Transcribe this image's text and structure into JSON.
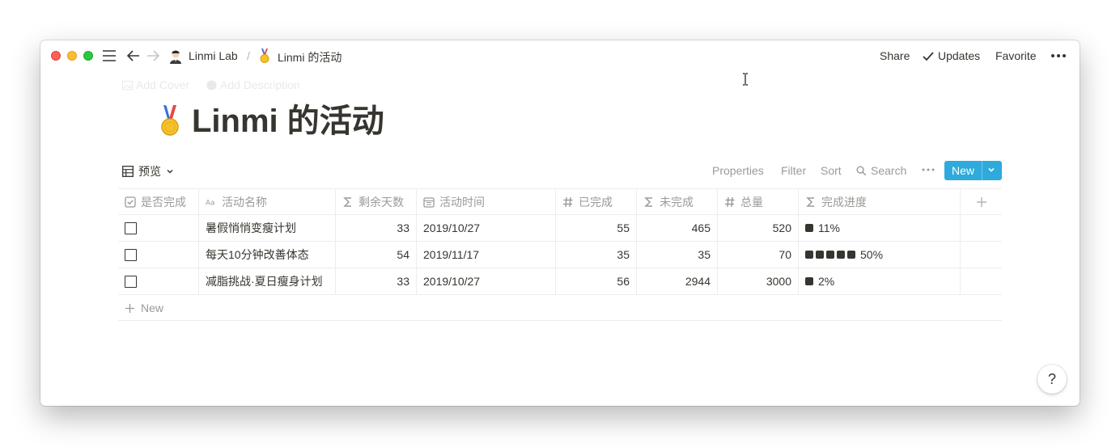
{
  "breadcrumb": {
    "workspace": "Linmi Lab",
    "separator": "/",
    "page": "Linmi 的活动"
  },
  "topbar": {
    "share": "Share",
    "updates": "Updates",
    "favorite": "Favorite"
  },
  "page_actions": {
    "add_cover": "Add Cover",
    "add_description": "Add Description"
  },
  "page": {
    "title": "Linmi 的活动",
    "icon": "medal-icon"
  },
  "view": {
    "name": "预览"
  },
  "toolbar": {
    "properties": "Properties",
    "filter": "Filter",
    "sort": "Sort",
    "search": "Search",
    "new": "New"
  },
  "table": {
    "columns": [
      {
        "label": "是否完成",
        "icon": "checkbox-icon"
      },
      {
        "label": "活动名称",
        "icon": "text-icon"
      },
      {
        "label": "剩余天数",
        "icon": "formula-icon"
      },
      {
        "label": "活动时间",
        "icon": "calendar-icon"
      },
      {
        "label": "已完成",
        "icon": "number-icon"
      },
      {
        "label": "未完成",
        "icon": "formula-icon"
      },
      {
        "label": "总量",
        "icon": "number-icon"
      },
      {
        "label": "完成进度",
        "icon": "formula-icon"
      }
    ],
    "rows": [
      {
        "done": false,
        "name": "暑假悄悄变瘦计划",
        "days_left": "33",
        "date": "2019/10/27",
        "completed": "55",
        "remaining": "465",
        "total": "520",
        "progress_text": "11%",
        "progress": 0.11
      },
      {
        "done": false,
        "name": "每天10分钟改善体态",
        "days_left": "54",
        "date": "2019/11/17",
        "completed": "35",
        "remaining": "35",
        "total": "70",
        "progress_text": "50%",
        "progress": 0.5
      },
      {
        "done": false,
        "name": "减脂挑战·夏日瘦身计划",
        "days_left": "33",
        "date": "2019/10/27",
        "completed": "56",
        "remaining": "2944",
        "total": "3000",
        "progress_text": "2%",
        "progress": 0.02
      }
    ],
    "new_row": "New"
  },
  "help": "?",
  "colors": {
    "accent": "#2eaadc",
    "text": "#37352f",
    "muted": "#9b9a97"
  }
}
